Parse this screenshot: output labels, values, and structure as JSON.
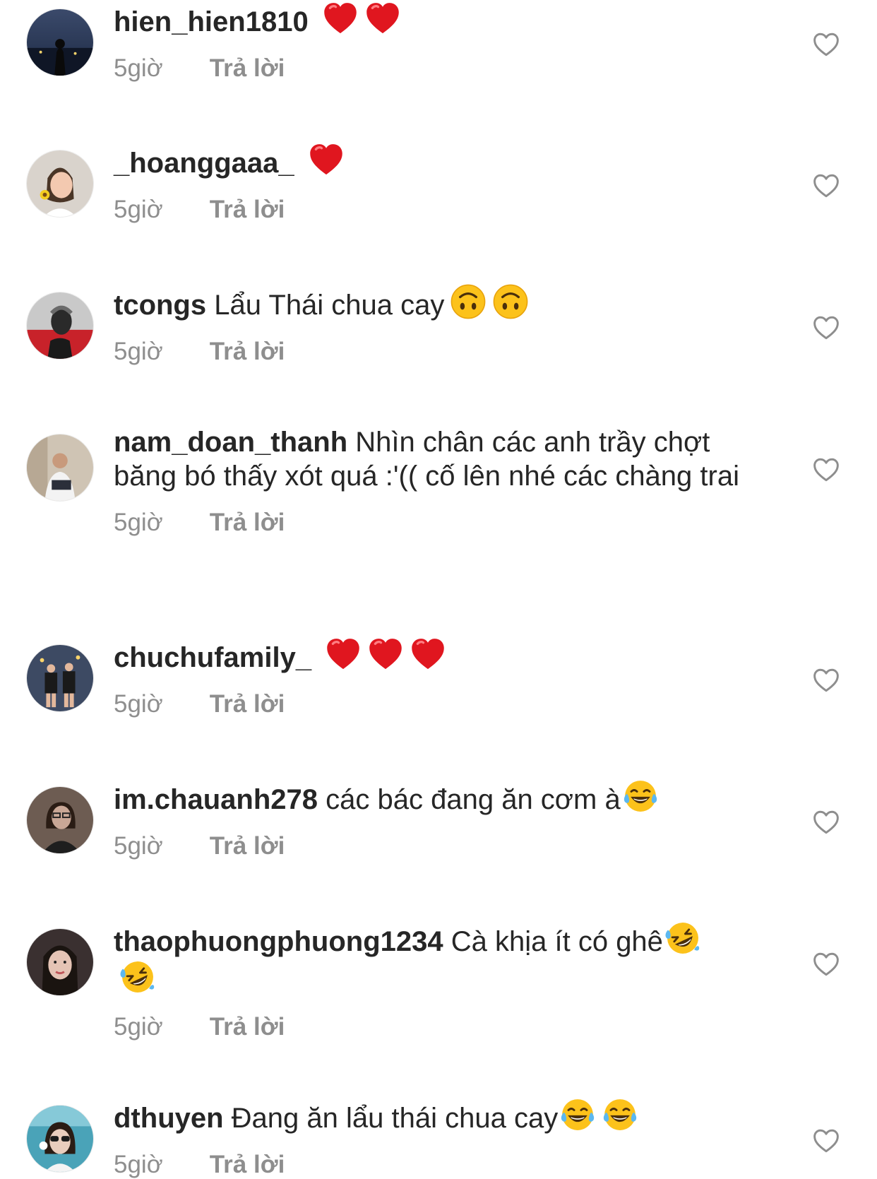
{
  "comments": [
    {
      "username": "hien_hien1810",
      "text": "",
      "emojis": [
        "red-heart",
        "red-heart"
      ],
      "emojis_wrap": false,
      "time": "5giờ",
      "reply": "Trả lời",
      "avatar_colors": [
        "#1d2a44",
        "#3b4a6b"
      ]
    },
    {
      "username": "_hoanggaaa_",
      "text": "",
      "emojis": [
        "red-heart"
      ],
      "emojis_wrap": false,
      "time": "5giờ",
      "reply": "Trả lời",
      "avatar_colors": [
        "#d9d3cc",
        "#f3c9b0"
      ]
    },
    {
      "username": "tcongs",
      "text": "Lẩu Thái chua cay",
      "emojis": [
        "upside-down-face",
        "upside-down-face"
      ],
      "emojis_wrap": false,
      "time": "5giờ",
      "reply": "Trả lời",
      "avatar_colors": [
        "#c9c9c9",
        "#c8222a"
      ]
    },
    {
      "username": "nam_doan_thanh",
      "text": "Nhìn chân các anh trầy chợt băng bó thấy xót quá :'(( cố lên nhé các chàng trai",
      "emojis": [],
      "emojis_wrap": false,
      "time": "5giờ",
      "reply": "Trả lời",
      "avatar_colors": [
        "#cfc4b4",
        "#2b2f3a"
      ]
    },
    {
      "username": "chuchufamily_",
      "text": "",
      "emojis": [
        "red-heart",
        "red-heart",
        "red-heart"
      ],
      "emojis_wrap": false,
      "time": "5giờ",
      "reply": "Trả lời",
      "avatar_colors": [
        "#3d4a63",
        "#1a1a1a"
      ]
    },
    {
      "username": "im.chauanh278",
      "text": "các bác đang ăn cơm à",
      "emojis": [
        "tears-of-joy"
      ],
      "emojis_wrap": false,
      "time": "5giờ",
      "reply": "Trả lời",
      "avatar_colors": [
        "#6d5c52",
        "#c9a796"
      ]
    },
    {
      "username": "thaophuongphuong1234",
      "text": "Cà khịa ít có ghê",
      "emojis": [
        "rolling-on-floor-laughing",
        "rolling-on-floor-laughing"
      ],
      "emojis_wrap": true,
      "time": "5giờ",
      "reply": "Trả lời",
      "avatar_colors": [
        "#3a3030",
        "#e5c4b5"
      ]
    },
    {
      "username": "dthuyen",
      "text": "Đang ăn lẩu thái chua cay",
      "emojis": [
        "tears-of-joy",
        "tears-of-joy"
      ],
      "emojis_wrap": false,
      "time": "5giờ",
      "reply": "Trả lời",
      "avatar_colors": [
        "#4aa3b8",
        "#e9cdbd"
      ]
    }
  ],
  "colors": {
    "text": "#262626",
    "meta": "#8e8e8e",
    "like_outline": "#8e8e8e"
  }
}
